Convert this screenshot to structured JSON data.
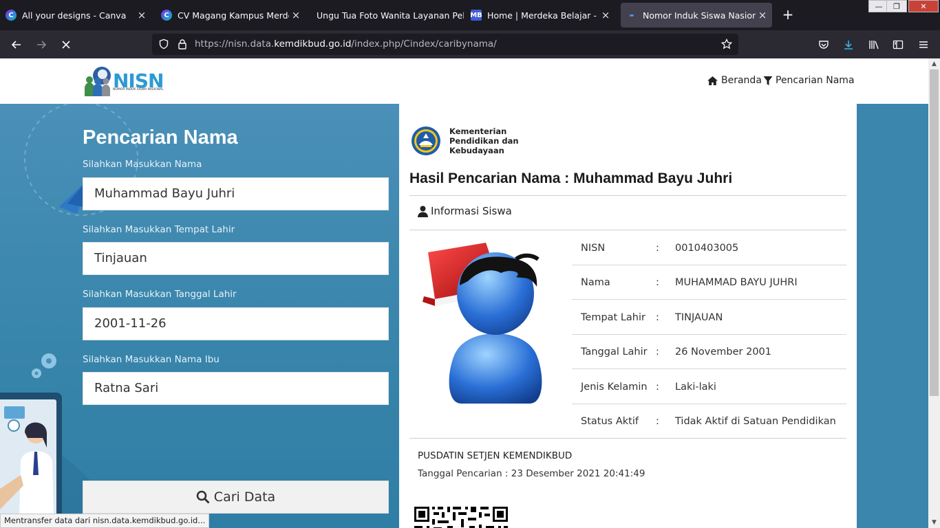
{
  "browser": {
    "tabs": [
      {
        "title": "All your designs - Canva",
        "favicon": "canva-icon",
        "active": false
      },
      {
        "title": "CV Magang Kampus Merdeka -",
        "favicon": "canva-icon",
        "active": false
      },
      {
        "title": "Ungu Tua Foto Wanita Layanan Pela",
        "favicon": "none",
        "active": false
      },
      {
        "title": "Home | Merdeka Belajar - Kamp",
        "favicon": "merdeka-icon",
        "active": false
      },
      {
        "title": "Nomor Induk Siswa Nasional",
        "favicon": "nisn-icon",
        "active": true
      }
    ],
    "url_prefix": "https://nisn.data.",
    "url_domain": "kemdikbud.go.id",
    "url_path": "/index.php/Cindex/caribynama/",
    "status_text": "Mentransfer data dari nisn.data.kemdikbud.go.id..."
  },
  "header": {
    "logo_text": "NISN",
    "logo_subtitle": "NOMOR INDUK SISWA NASIONAL",
    "nav_home": "Beranda",
    "nav_search": "Pencarian Nama"
  },
  "form": {
    "title": "Pencarian Nama",
    "name_label": "Silahkan Masukkan Nama",
    "name_value": "Muhammad Bayu Juhri",
    "birthplace_label": "Silahkan Masukkan Tempat Lahir",
    "birthplace_value": "Tinjauan",
    "birthdate_label": "Silahkan Masukkan Tanggal Lahir",
    "birthdate_value": "2001-11-26",
    "mother_label": "Silahkan Masukkan Nama Ibu",
    "mother_value": "Ratna Sari",
    "submit_label": "Cari Data"
  },
  "result": {
    "ministry_line1": "Kementerian",
    "ministry_line2": "Pendidikan dan",
    "ministry_line3": "Kebudayaan",
    "title": "Hasil Pencarian Nama : Muhammad Bayu Juhri",
    "section_title": "Informasi Siswa",
    "fields": [
      {
        "label": "NISN",
        "sep": ":",
        "value": "0010403005"
      },
      {
        "label": "Nama",
        "sep": ":",
        "value": "MUHAMMAD BAYU JUHRI"
      },
      {
        "label": "Tempat Lahir",
        "sep": ":",
        "value": "TINJAUAN"
      },
      {
        "label": "Tanggal Lahir",
        "sep": ":",
        "value": "26 November 2001"
      },
      {
        "label": "Jenis Kelamin",
        "sep": ":",
        "value": "Laki-laki"
      },
      {
        "label": "Status Aktif",
        "sep": ":",
        "value": "Tidak Aktif di Satuan Pendidikan"
      }
    ],
    "footer_org": "PUSDATIN SETJEN KEMENDIKBUD",
    "search_date": "Tanggal Pencarian : 23 Desember 2021 20:41:49"
  },
  "colors": {
    "browser_dark": "#1c1b22",
    "browser_nav": "#2b2a33",
    "panel_blue": "#3b87ad",
    "nisn_blue": "#2d9ad6"
  }
}
